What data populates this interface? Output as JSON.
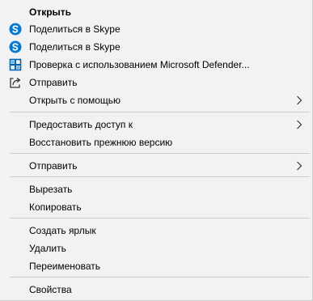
{
  "menu": {
    "items": [
      {
        "label": "Открыть"
      },
      {
        "label": "Поделиться в Skype",
        "icon": "skype-icon"
      },
      {
        "label": "Поделиться в Skype",
        "icon": "skype-icon"
      },
      {
        "label": "Проверка с использованием Microsoft Defender...",
        "icon": "defender-shield-icon"
      },
      {
        "label": "Отправить",
        "icon": "share-icon"
      },
      {
        "label": "Открыть с помощью",
        "submenu": true
      },
      {
        "label": "Предоставить доступ к",
        "submenu": true
      },
      {
        "label": "Восстановить прежнюю версию"
      },
      {
        "label": "Отправить",
        "submenu": true
      },
      {
        "label": "Вырезать"
      },
      {
        "label": "Копировать"
      },
      {
        "label": "Создать ярлык"
      },
      {
        "label": "Удалить"
      },
      {
        "label": "Переименовать"
      },
      {
        "label": "Свойства"
      }
    ]
  },
  "colors": {
    "menu_background": "#f2f2f2",
    "separator": "#cccccc",
    "skype_blue": "#0078d7",
    "defender_blue": "#0063b1"
  }
}
